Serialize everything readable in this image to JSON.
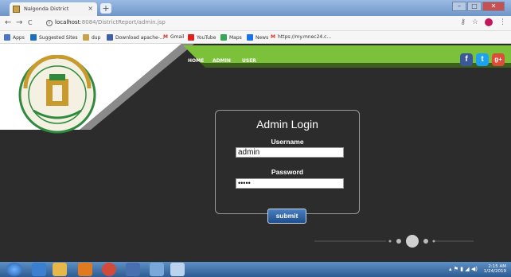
{
  "browser": {
    "tab_title": "Nalgonda District",
    "tab_close": "×",
    "new_tab": "+",
    "url_host": "localhost",
    "url_rest": ":8084/DistrictReport/admin.jsp",
    "back": "←",
    "forward": "→",
    "reload": "C",
    "bookmarks": [
      {
        "label": "Apps",
        "color": "#4a76c9"
      },
      {
        "label": "Suggested Sites",
        "color": "#1d6fb8"
      },
      {
        "label": "dup",
        "color": "#c8a24a"
      },
      {
        "label": "Download apache-...",
        "color": "#3f5fa8"
      },
      {
        "label": "Gmail",
        "color": "#d93025"
      },
      {
        "label": "YouTube",
        "color": "#e02020"
      },
      {
        "label": "Maps",
        "color": "#34a853"
      },
      {
        "label": "News",
        "color": "#1a73e8"
      },
      {
        "label": "https://my.mnec24.c...",
        "color": "#d93025"
      }
    ]
  },
  "nav": {
    "home": "HOME",
    "admin": "ADMIN",
    "user": "USER",
    "social": [
      {
        "name": "facebook",
        "glyph": "f",
        "color": "#3b5998"
      },
      {
        "name": "twitter",
        "glyph": "t",
        "color": "#1da1f2"
      },
      {
        "name": "google-plus",
        "glyph": "g+",
        "color": "#dd4b39"
      }
    ],
    "accent_color": "#7cc13a"
  },
  "login": {
    "title": "Admin Login",
    "username_label": "Username",
    "username_value": "admin",
    "password_label": "Password",
    "password_value": "•••••",
    "submit_label": "submit"
  },
  "taskbar": {
    "time": "2:15 AM",
    "date": "1/24/2019"
  }
}
